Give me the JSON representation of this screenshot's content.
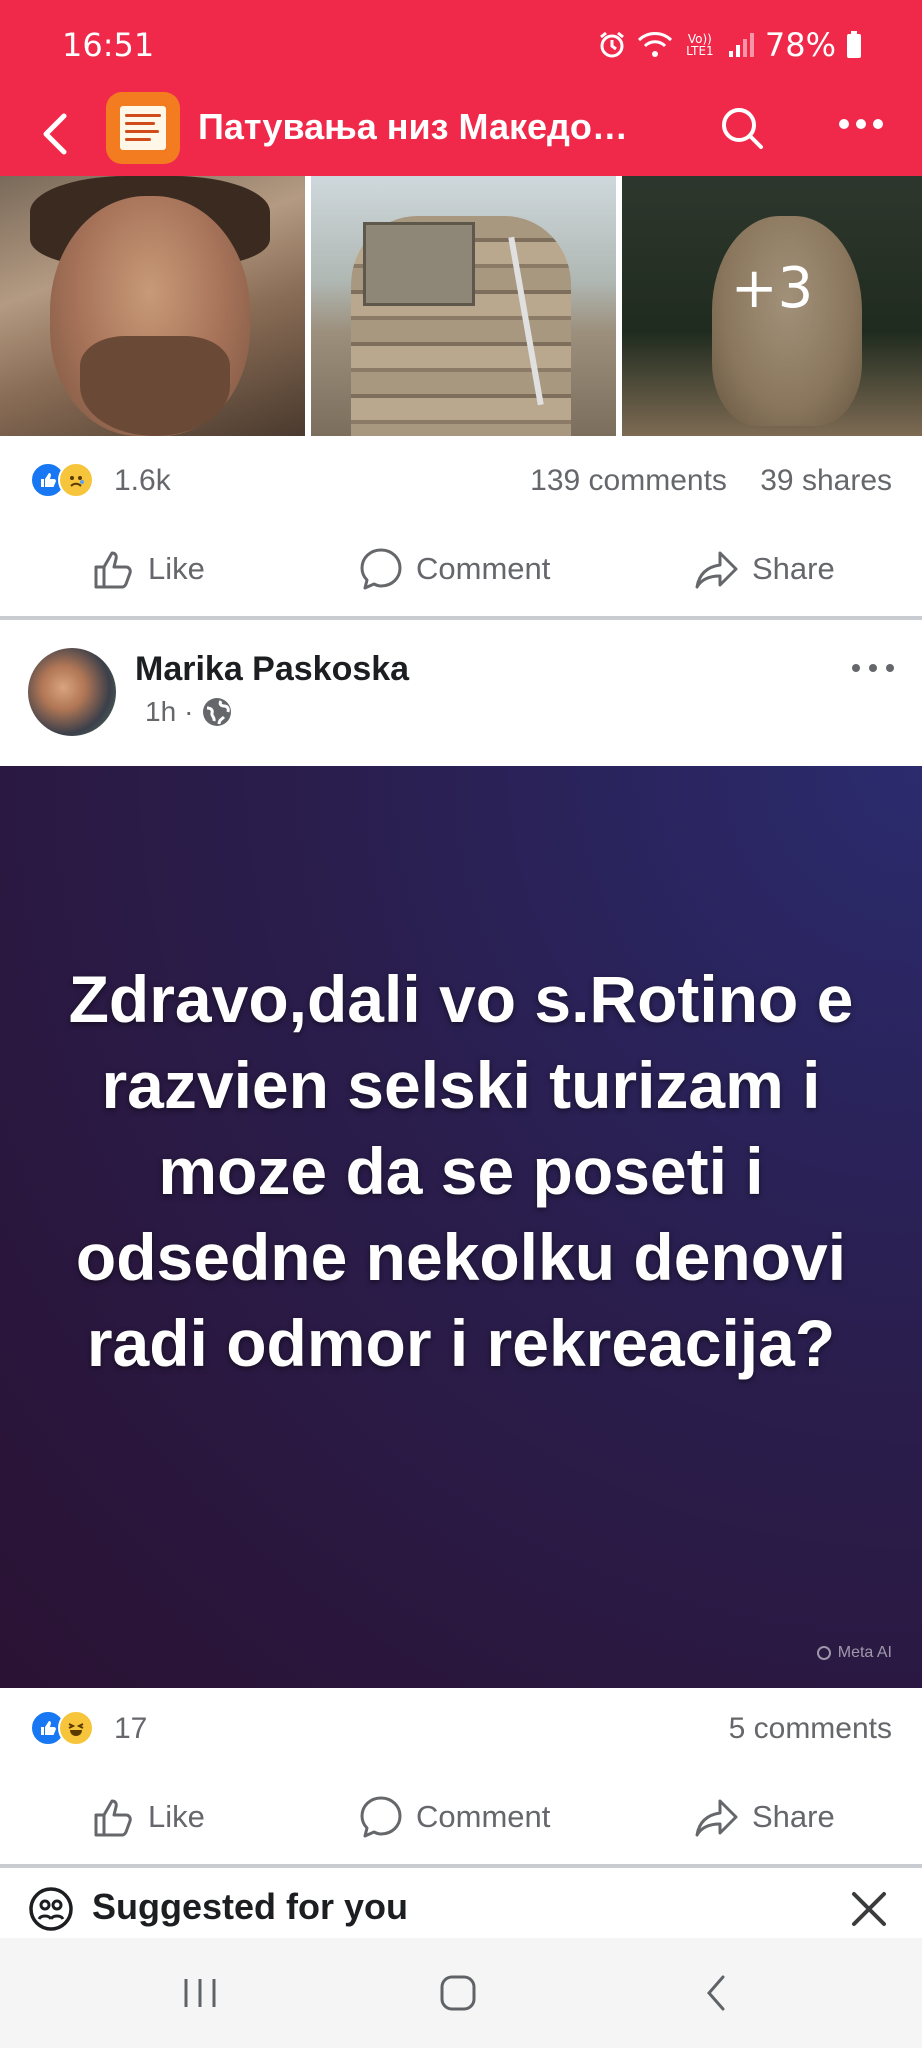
{
  "status_bar": {
    "time": "16:51",
    "battery": "78%",
    "network_label": "Vo)) LTE1"
  },
  "header": {
    "title": "Патувања низ Македо…"
  },
  "post1": {
    "more_photos": "+3",
    "reaction_count": "1.6k",
    "comments": "139 comments",
    "shares": "39 shares"
  },
  "actions": {
    "like": "Like",
    "comment": "Comment",
    "share": "Share"
  },
  "post2": {
    "author": "Marika Paskoska",
    "time": "1h",
    "body": "Zdravo,dali vo s.Rotino e razvien selski turizam i moze da se poseti i odsedne nekolku denovi radi odmor i rekreacija?",
    "watermark": "Meta AI",
    "reaction_count": "17",
    "comments": "5 comments"
  },
  "suggested": {
    "title": "Suggested for you"
  },
  "colors": {
    "header_bg": "#f0284a",
    "like_blue": "#1877f2",
    "secondary_text": "#65676b"
  },
  "icons": [
    "back-arrow-icon",
    "search-icon",
    "more-dots-icon",
    "like-reaction-icon",
    "sad-reaction-icon",
    "haha-reaction-icon",
    "thumbs-up-icon",
    "comment-bubble-icon",
    "share-arrow-icon",
    "globe-icon",
    "suggested-people-icon",
    "close-icon"
  ]
}
